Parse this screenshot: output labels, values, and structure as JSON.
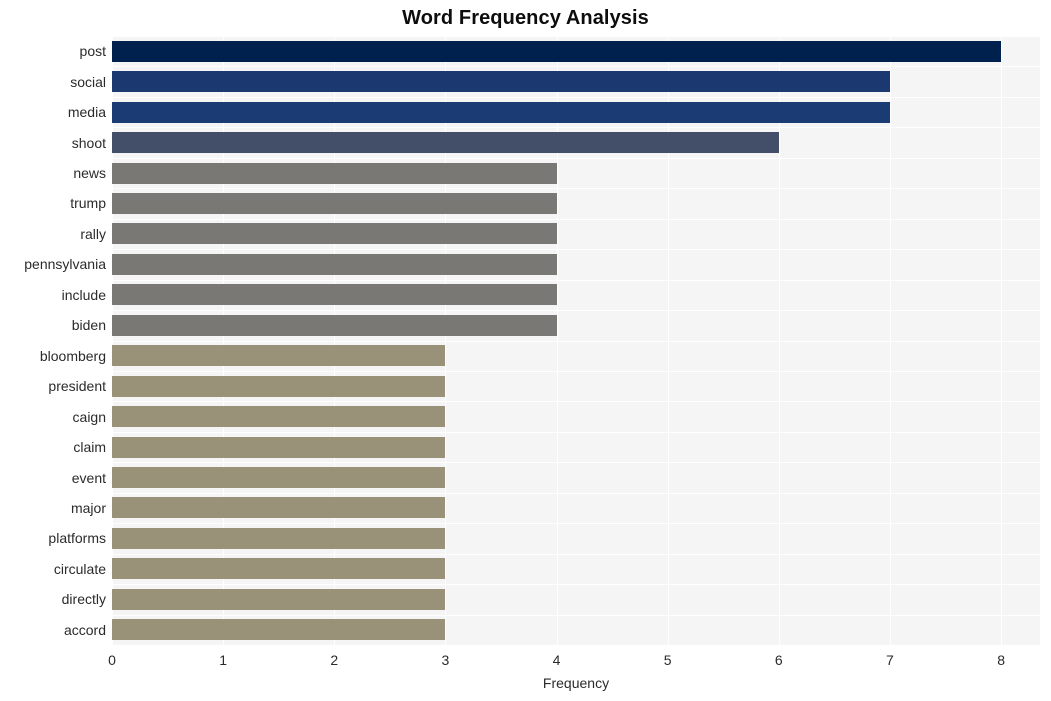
{
  "chart_data": {
    "type": "bar",
    "orientation": "horizontal",
    "title": "Word Frequency Analysis",
    "xlabel": "Frequency",
    "ylabel": "",
    "categories": [
      "post",
      "social",
      "media",
      "shoot",
      "news",
      "trump",
      "rally",
      "pennsylvania",
      "include",
      "biden",
      "bloomberg",
      "president",
      "caign",
      "claim",
      "event",
      "major",
      "platforms",
      "circulate",
      "directly",
      "accord"
    ],
    "values": [
      8,
      7,
      7,
      6,
      4,
      4,
      4,
      4,
      4,
      4,
      3,
      3,
      3,
      3,
      3,
      3,
      3,
      3,
      3,
      3
    ],
    "bar_colors": [
      "#00204e",
      "#1b3970",
      "#1b3b74",
      "#434f69",
      "#7a7875",
      "#7a7875",
      "#7a7875",
      "#7a7875",
      "#7a7875",
      "#7a7875",
      "#9a9278",
      "#9a9278",
      "#9a9278",
      "#9a9278",
      "#9a9278",
      "#9a9278",
      "#9a9278",
      "#9a9278",
      "#9a9278",
      "#9a9278"
    ],
    "xlim": [
      0,
      8.35
    ],
    "xticks": [
      0,
      1,
      2,
      3,
      4,
      5,
      6,
      7,
      8
    ],
    "xtick_labels": [
      "0",
      "1",
      "2",
      "3",
      "4",
      "5",
      "6",
      "7",
      "8"
    ],
    "grid": true,
    "grid_color": "#ffffff",
    "plot_background": "#f5f5f6",
    "figure_background": "#ffffff",
    "legend": null,
    "title_color": "#0d0d0d",
    "tick_color": "#2b2b2b"
  }
}
